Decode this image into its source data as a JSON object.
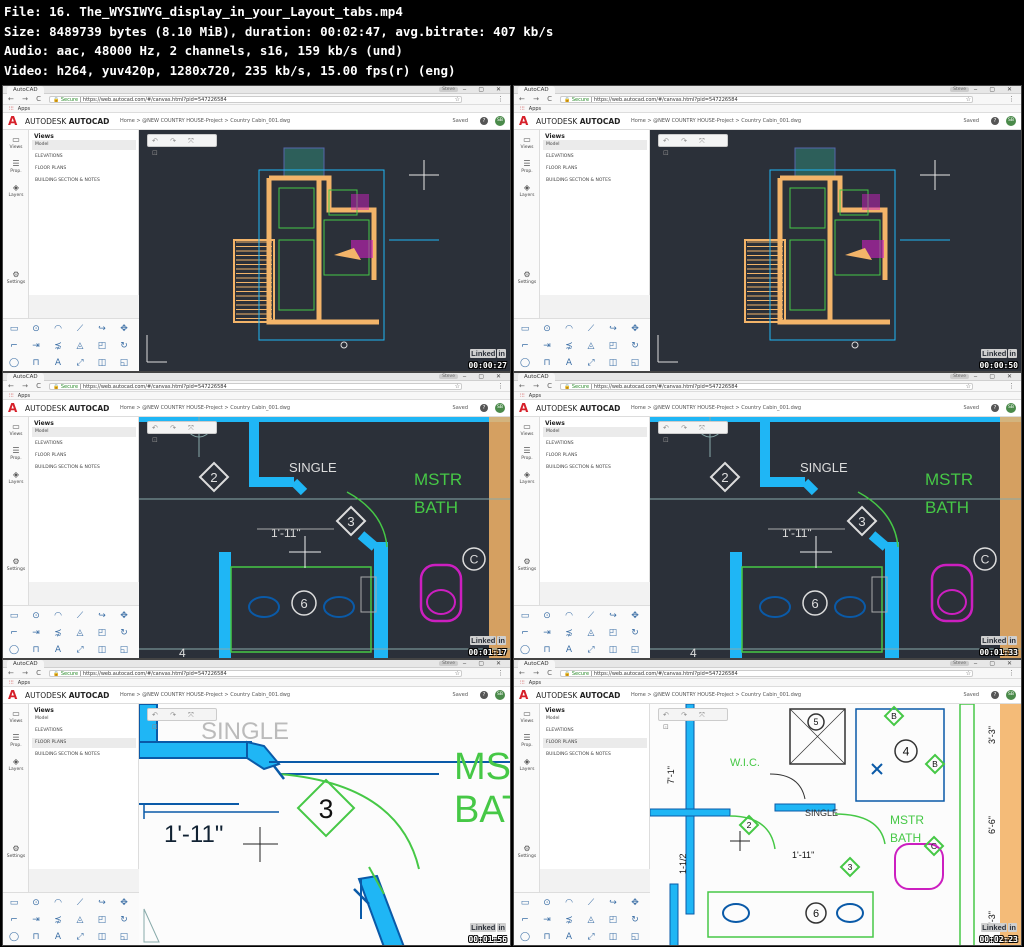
{
  "meta": {
    "line1": "File: 16. The_WYSIWYG_display_in_your_Layout_tabs.mp4",
    "line2": "Size: 8489739 bytes (8.10 MiB), duration: 00:02:47, avg.bitrate: 407 kb/s",
    "line3": "Audio: aac, 48000 Hz, 2 channels, s16, 159 kb/s (und)",
    "line4": "Video: h264, yuv420p, 1280x720, 235 kb/s, 15.00 fps(r) (eng)"
  },
  "app": {
    "tab_title": "AutoCAD",
    "user_chip": "Steve",
    "nav_buttons": "← → C ⌂",
    "secure_label": "Secure",
    "url": "https://web.autocad.com/#/canvas.html?pid=547226584",
    "apps_label": "Apps",
    "brand_prefix": "AUTODESK",
    "brand_name": "AUTOCAD",
    "logo_letter": "A",
    "breadcrumb": "Home > @NEW COUNTRY HOUSE-Project > Country Cabin_001.dwg",
    "saved_label": "Saved",
    "help_label": "?",
    "avatar_initials": "SB"
  },
  "rail": [
    {
      "icon": "▭",
      "label": "Views"
    },
    {
      "icon": "☰",
      "label": "Prop."
    },
    {
      "icon": "◈",
      "label": "Layers"
    },
    {
      "icon": "⚙",
      "label": "Settings"
    }
  ],
  "panel": {
    "title": "Views",
    "items": [
      "Model",
      "ELEVATIONS",
      "FLOOR PLANS",
      "BUILDING SECTION & NOTES"
    ]
  },
  "canvas_tools": "↶ ↷ ⤧ ⊡",
  "watermark": {
    "text": "Linked",
    "box": "in"
  },
  "plan_labels": {
    "single": "SINGLE",
    "mstr": "MSTR",
    "bath": "BATH",
    "dim": "1'-11\"",
    "tag2": "2",
    "tag3": "3",
    "tag4": "4",
    "tag5": "5",
    "tag6": "6",
    "tagB": "B",
    "tagC": "C",
    "wic": "W.I.C.",
    "dim_a": "7'-1\"",
    "dim_b": "3'-3\"",
    "dim_c": "6'-6\"",
    "dim_d": "1-1/2"
  },
  "frames": [
    {
      "time": "00:00:27",
      "view": "overview",
      "selected_item": 0
    },
    {
      "time": "00:00:50",
      "view": "overview",
      "selected_item": 0
    },
    {
      "time": "00:01:17",
      "view": "zoom-dark",
      "selected_item": 0
    },
    {
      "time": "00:01:33",
      "view": "zoom-dark",
      "selected_item": 0
    },
    {
      "time": "00:01:56",
      "view": "zoom-light",
      "selected_item": 2
    },
    {
      "time": "00:02:23",
      "view": "plan-light",
      "selected_item": 2
    }
  ],
  "colors": {
    "canvas_dark": "#2b3039",
    "canvas_light": "#fcfcfc",
    "wall_blue": "#1fb6f5",
    "wall_dark_blue": "#0a5aa8",
    "room_green": "#46c846",
    "magenta": "#cc1fc0",
    "wood": "#f3b469",
    "autodesk_red": "#d6202a"
  }
}
